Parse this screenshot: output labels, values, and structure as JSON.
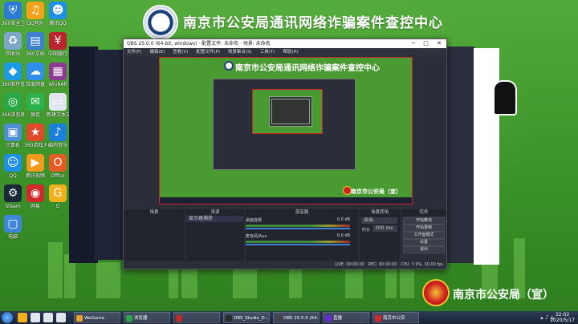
{
  "banner": {
    "title": "南京市公安局通讯网络诈骗案件查控中心"
  },
  "footer_brand": {
    "text": "南京市公安局（宣）"
  },
  "desktop_icons": [
    {
      "label": "360安全卫士",
      "icon": "shield-icon",
      "color": "#2b7bd6"
    },
    {
      "label": "QQ音乐",
      "icon": "music-icon",
      "color": "#f4a21c"
    },
    {
      "label": "腾讯QQ",
      "icon": "penguin-icon",
      "color": "#1d8fe6"
    },
    {
      "label": "回收站",
      "icon": "recycle-bin-icon",
      "color": "#7da7c9"
    },
    {
      "label": "360文档",
      "icon": "doc-icon",
      "color": "#3f7fd0"
    },
    {
      "label": "中国银行",
      "icon": "bank-icon",
      "color": "#b8252b"
    },
    {
      "label": "360软件管家",
      "icon": "box-icon",
      "color": "#1d9ae6"
    },
    {
      "label": "百度网盘",
      "icon": "cloud-icon",
      "color": "#2f8fe8"
    },
    {
      "label": "WinRAR",
      "icon": "archive-icon",
      "color": "#8b3a8f"
    },
    {
      "label": "360浏览器",
      "icon": "browser-icon",
      "color": "#2aa847"
    },
    {
      "label": "微信",
      "icon": "chat-icon",
      "color": "#2bb24c"
    },
    {
      "label": "新建文本文档",
      "icon": "file-icon",
      "color": "#dfe6ee"
    },
    {
      "label": "计算机",
      "icon": "computer-icon",
      "color": "#4d8fd3"
    },
    {
      "label": "360游戏大厅",
      "icon": "game-icon",
      "color": "#e24a2c"
    },
    {
      "label": "酷狗音乐",
      "icon": "note-icon",
      "color": "#1c7fd9"
    },
    {
      "label": "QQ",
      "icon": "qq-icon",
      "color": "#1d8fe6"
    },
    {
      "label": "腾讯视频",
      "icon": "video-icon",
      "color": "#f29b1d"
    },
    {
      "label": "Office",
      "icon": "office-icon",
      "color": "#e65a24"
    },
    {
      "label": "Steam",
      "icon": "steam-icon",
      "color": "#1b2838"
    },
    {
      "label": "网易",
      "icon": "app-icon",
      "color": "#d22a2a"
    },
    {
      "label": "G",
      "icon": "g-icon",
      "color": "#f2b11c"
    },
    {
      "label": "电脑",
      "icon": "monitor-icon",
      "color": "#3e86d8"
    }
  ],
  "obs": {
    "title": "OBS 25.0.0 (64-bit, windows)  · 配置文件: 未命名 · 场景: 未命名",
    "menu": [
      "文件(F)",
      "编辑(E)",
      "查看(V)",
      "配置文件(P)",
      "场景集合(S)",
      "工具(T)",
      "帮助(H)"
    ],
    "docks": {
      "scenes": "场景",
      "sources": "来源",
      "mixer": "混音器",
      "transitions": "场景转场",
      "controls": "控件"
    },
    "sources": [
      "显示器捕获"
    ],
    "mixer": [
      {
        "name": "桌面音频",
        "value": "0.0 dB"
      },
      {
        "name": "麦克风/Aux",
        "value": "0.0 dB"
      }
    ],
    "transition": {
      "type": "淡出",
      "duration_label": "时长",
      "duration": "300 ms"
    },
    "controls": [
      "开始推流",
      "开始录制",
      "工作室模式",
      "设置",
      "退出"
    ],
    "status": {
      "live": "LIVE: 00:00:00",
      "rec": "REC: 00:00:00",
      "cpu": "CPU: 7.9%, 30.00 fps"
    }
  },
  "taskbar": {
    "apps": [
      {
        "label": "WeGame",
        "color": "#e8a22a"
      },
      {
        "label": "浏览器",
        "color": "#2aa847"
      },
      {
        "label": "",
        "color": "#c22a2a"
      },
      {
        "label": "OBS_Studio_D...",
        "color": "#2b2b2b"
      },
      {
        "label": "OBS 25.0.0 (64...",
        "color": "#444"
      },
      {
        "label": "直播",
        "color": "#6a2ad6"
      },
      {
        "label": "南京市公安",
        "color": "#d22a2a"
      }
    ],
    "time": "22:02",
    "date": "2020/5/17"
  }
}
